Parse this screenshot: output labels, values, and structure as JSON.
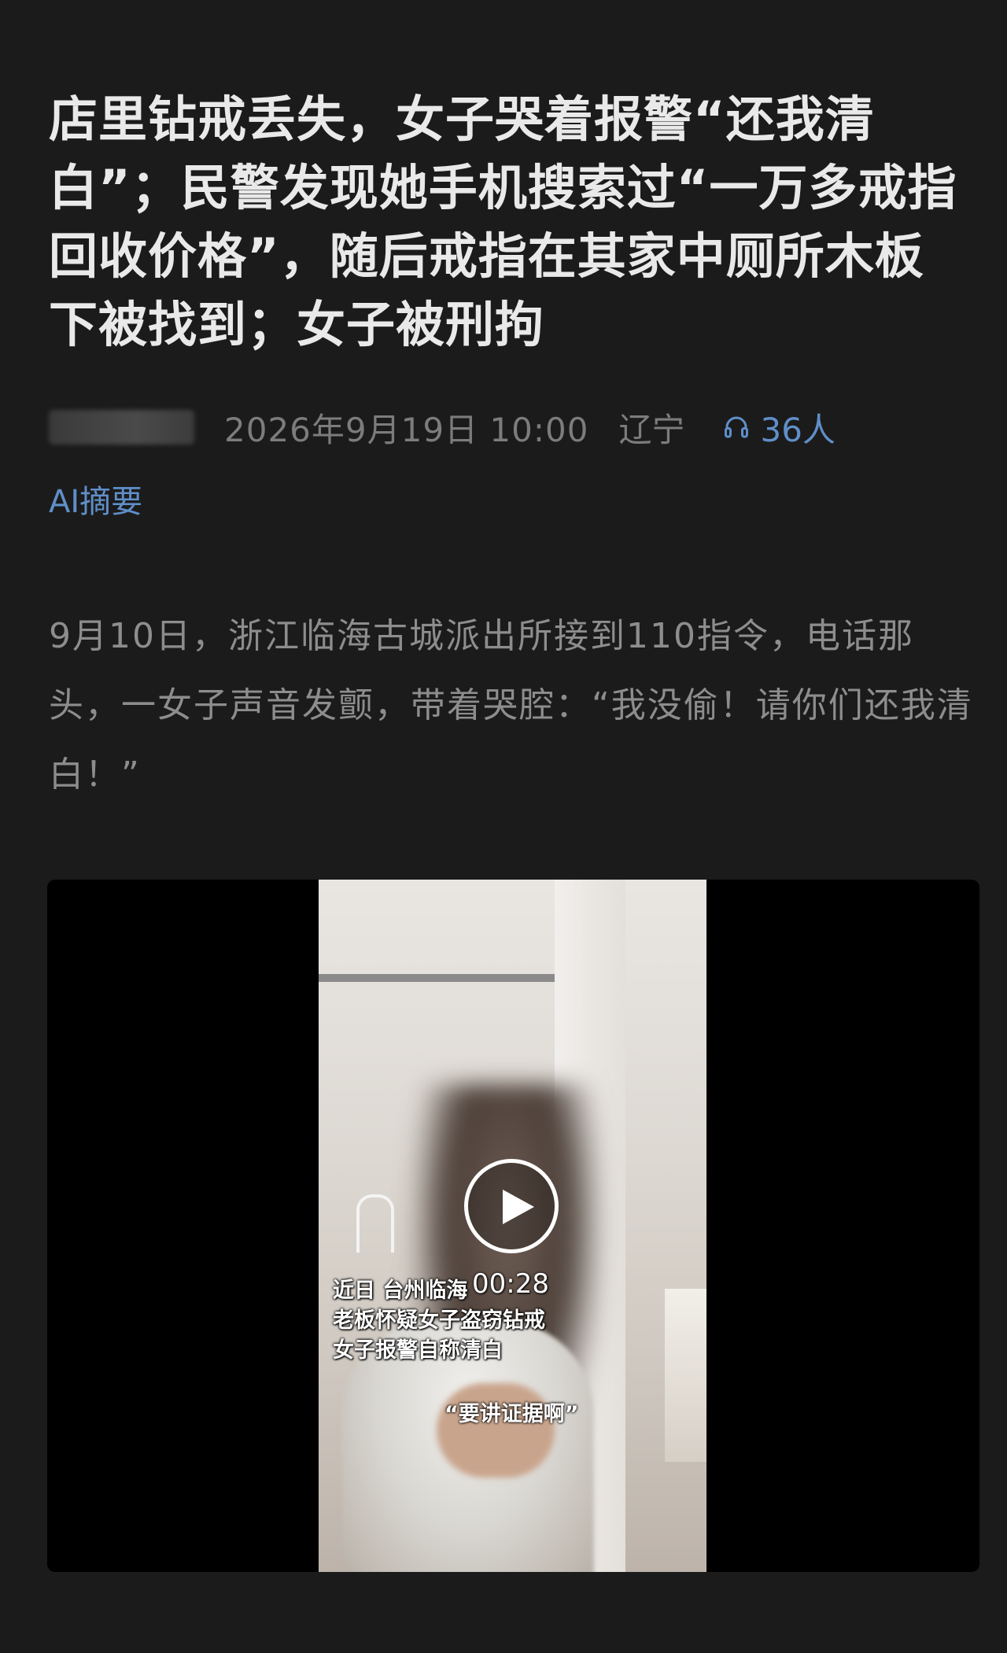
{
  "article": {
    "title": "店里钻戒丢失，女子哭着报警“还我清白”；民警发现她手机搜索过“一万多戒指回收价格”，随后戒指在其家中厕所木板下被找到；女子被刑拘",
    "date": "2026年9月19日 10:00",
    "region": "辽宁",
    "listeners": "36人",
    "ai_summary_label": "AI摘要",
    "body": "9月10日，浙江临海古城派出所接到110指令，电话那头，一女子声音发颤，带着哭腔：“我没偷！请你们还我清白！”"
  },
  "video": {
    "duration": "00:28",
    "caption_line1": "近日 台州临海",
    "caption_line2": "老板怀疑女子盗窃钻戒",
    "caption_line3": "女子报警自称清白",
    "quote": "“要讲证据啊”"
  },
  "colors": {
    "background": "#1b1b1b",
    "title": "#e9e9e9",
    "meta": "#7c7c7c",
    "accent_link": "#5f8fc9",
    "body_text": "#8d8d8d"
  },
  "icons": {
    "listen": "headphones-icon",
    "play": "play-icon"
  }
}
